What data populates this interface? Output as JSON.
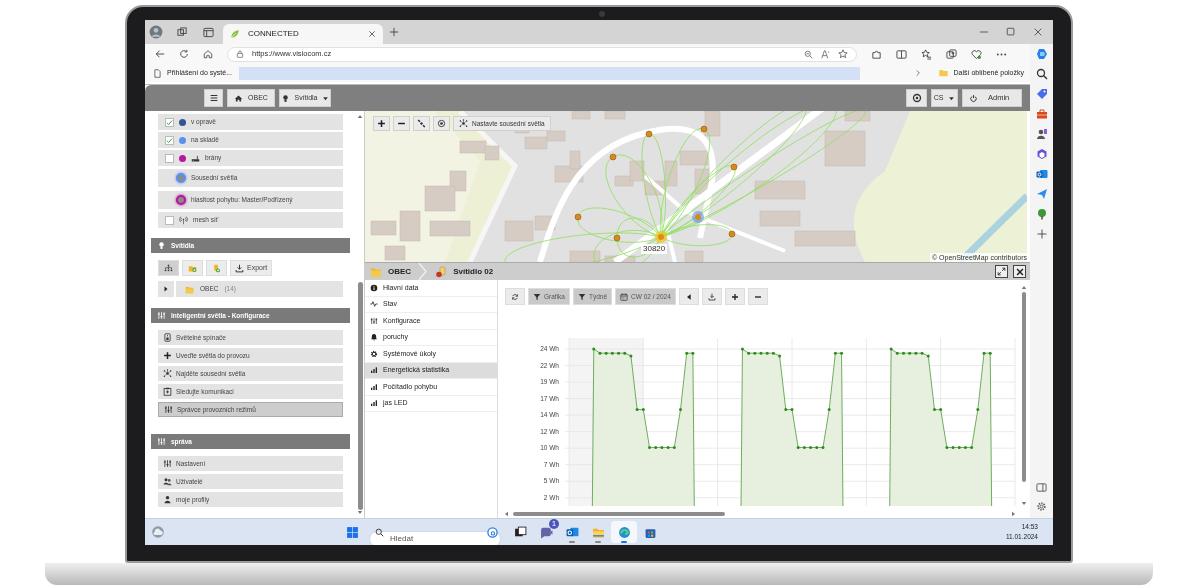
{
  "browser": {
    "tab_title": "CONNECTED",
    "url": "https://www.visiocom.cz",
    "favorite": "Přihlášení do systé...",
    "other_favorites": "Další oblíbené položky"
  },
  "header": {
    "home": "OBEC",
    "menu": "Svítidla",
    "language": "CS",
    "user": "Admin"
  },
  "layers": [
    {
      "kind": "check",
      "label": "v opravě",
      "checked": true,
      "color": "#2f5597"
    },
    {
      "kind": "check",
      "label": "na skladě",
      "checked": true,
      "color": "#5b8ff0"
    },
    {
      "kind": "gateway",
      "label": "brány",
      "checked": false,
      "color": "#b5179e"
    },
    {
      "kind": "halo",
      "label": "Sousední světla",
      "color": "#5b8ff0"
    },
    {
      "kind": "halo",
      "label": "hlasitost pohybu: Master/Podřízený",
      "color": "#b5179e"
    },
    {
      "kind": "mesh",
      "label": "mesh síť",
      "checked": false
    }
  ],
  "luminaires": {
    "title": "Svítidla",
    "toolbar": [
      {
        "kind": "tree",
        "selected": true
      },
      {
        "kind": "folder-add",
        "selected": false
      },
      {
        "kind": "add",
        "selected": false
      },
      {
        "kind": "export",
        "label": "Export",
        "selected": false
      }
    ],
    "tree": [
      {
        "label": "OBEC",
        "count": "(14)",
        "expanded": false
      }
    ]
  },
  "config": {
    "title": "Inteligentní světla - Konfigurace",
    "items": [
      {
        "kind": "switch",
        "label": "Světelné spínače",
        "selected": false
      },
      {
        "kind": "add",
        "label": "Uveďte světla do provozu",
        "selected": false
      },
      {
        "kind": "neighbors",
        "label": "Najděte sousední světla",
        "selected": false
      },
      {
        "kind": "monitor",
        "label": "Sledujte komunikaci",
        "selected": false
      },
      {
        "kind": "modes",
        "label": "Správce provozních režimů",
        "selected": true
      }
    ]
  },
  "admin": {
    "title": "správa",
    "items": [
      {
        "kind": "settings",
        "label": "Nastavení",
        "selected": false
      },
      {
        "kind": "users",
        "label": "Uživatelé",
        "selected": false
      },
      {
        "kind": "profile",
        "label": "moje profily",
        "selected": false
      }
    ]
  },
  "map": {
    "controls": [
      {
        "kind": "zoom-in"
      },
      {
        "kind": "zoom-out"
      },
      {
        "kind": "satellite"
      },
      {
        "kind": "locate"
      },
      {
        "kind": "neighbors",
        "label": "Nastavte sousední světla"
      }
    ],
    "marker_label": "30820",
    "attribution": "© OpenStreetMap contributors"
  },
  "detail": {
    "breadcrumb": [
      {
        "kind": "folder",
        "label": "OBEC"
      },
      {
        "kind": "lamp",
        "label": "Svítidlo 02"
      }
    ],
    "nav": [
      {
        "kind": "info",
        "label": "Hlavní data",
        "selected": false
      },
      {
        "kind": "pulse",
        "label": "Stav",
        "selected": false
      },
      {
        "kind": "sliders",
        "label": "Konfigurace",
        "selected": false
      },
      {
        "kind": "bell",
        "label": "poruchy",
        "selected": false
      },
      {
        "kind": "gear",
        "label": "Systémové úkoly",
        "selected": false
      },
      {
        "kind": "bars",
        "label": "Energetická statistika",
        "selected": true
      },
      {
        "kind": "bars",
        "label": "Počítadlo pohybu",
        "selected": false
      },
      {
        "kind": "bars",
        "label": "jas LED",
        "selected": false
      }
    ],
    "toolbar": [
      {
        "kind": "refresh",
        "active": false
      },
      {
        "kind": "filter",
        "label": "Grafika",
        "active": true
      },
      {
        "kind": "filter",
        "label": "Týdně",
        "active": true
      },
      {
        "kind": "calendar",
        "label": "CW 02 / 2024",
        "active": true
      },
      {
        "kind": "prev",
        "active": false
      },
      {
        "kind": "download",
        "active": false
      },
      {
        "kind": "zoom-in",
        "active": false
      },
      {
        "kind": "zoom-out",
        "active": false
      }
    ],
    "chart_data": {
      "type": "area",
      "grid": true,
      "ylim": [
        1.2,
        25.6
      ],
      "yticks": [
        {
          "value": 2.4,
          "label": "2 Wh"
        },
        {
          "value": 4.8,
          "label": "5 Wh"
        },
        {
          "value": 7.2,
          "label": "7 Wh"
        },
        {
          "value": 9.6,
          "label": "10 Wh"
        },
        {
          "value": 12,
          "label": "12 Wh"
        },
        {
          "value": 14.4,
          "label": "14 Wh"
        },
        {
          "value": 16.8,
          "label": "17 Wh"
        },
        {
          "value": 19.2,
          "label": "19 Wh"
        },
        {
          "value": 21.6,
          "label": "22 Wh"
        },
        {
          "value": 24,
          "label": "24 Wh"
        }
      ],
      "values": [
        null,
        null,
        null,
        null,
        24,
        23.4,
        23.4,
        23.4,
        23.4,
        23.4,
        23,
        15.2,
        15.2,
        9.7,
        9.7,
        9.7,
        9.7,
        9.7,
        15.2,
        23.4,
        23.4,
        null,
        null,
        null,
        null,
        null,
        null,
        null,
        24,
        23.4,
        23.4,
        23.4,
        23.4,
        23.4,
        23,
        15.2,
        15.2,
        9.7,
        9.7,
        9.7,
        9.7,
        9.7,
        15.2,
        23.4,
        23.4,
        null,
        null,
        null,
        null,
        null,
        null,
        null,
        24,
        23.4,
        23.4,
        23.4,
        23.4,
        23.4,
        23,
        15.2,
        15.2,
        9.7,
        9.7,
        9.7,
        9.7,
        9.7,
        15.2,
        23.4,
        23.4,
        null,
        null,
        null
      ]
    }
  },
  "taskbar": {
    "search_placeholder": "Hledat",
    "apps": [
      {
        "kind": "task-view",
        "running": false,
        "active": false
      },
      {
        "kind": "chat",
        "badge": "1",
        "running": false,
        "active": false
      },
      {
        "kind": "mail",
        "running": true,
        "active": false
      },
      {
        "kind": "folder",
        "running": true,
        "active": false
      },
      {
        "kind": "browser",
        "running": true,
        "active": true
      },
      {
        "kind": "store",
        "running": false,
        "active": false
      }
    ],
    "time": "14:53",
    "date": "11.01.2024"
  }
}
